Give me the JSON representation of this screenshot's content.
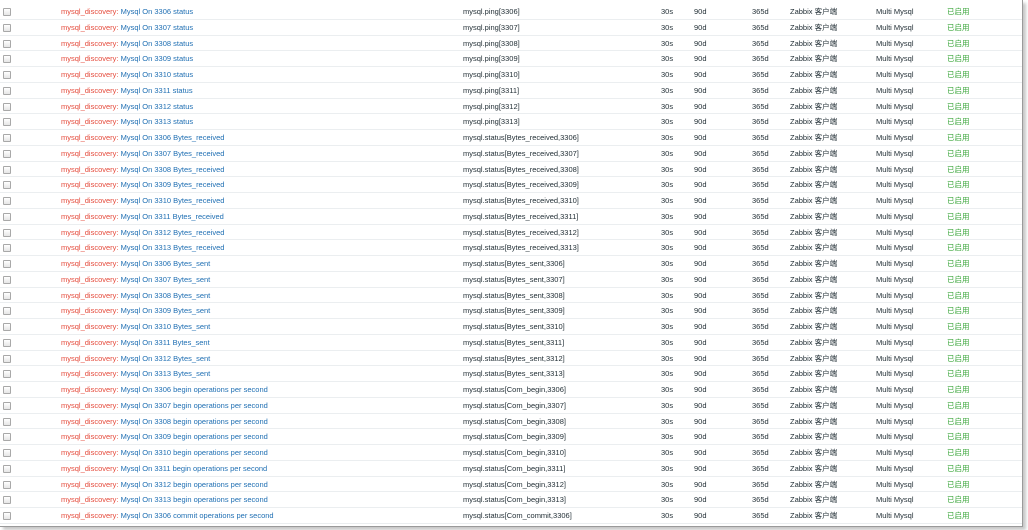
{
  "rows": [
    {
      "prefix": "mysql_discovery",
      "name": "Mysql On 3306 status",
      "key": "mysql.ping[3306]",
      "interval": "30s",
      "history": "90d",
      "trends": "365d",
      "type": "Zabbix 客户端",
      "app": "Multi Mysql",
      "status": "已启用"
    },
    {
      "prefix": "mysql_discovery",
      "name": "Mysql On 3307 status",
      "key": "mysql.ping[3307]",
      "interval": "30s",
      "history": "90d",
      "trends": "365d",
      "type": "Zabbix 客户端",
      "app": "Multi Mysql",
      "status": "已启用"
    },
    {
      "prefix": "mysql_discovery",
      "name": "Mysql On 3308 status",
      "key": "mysql.ping[3308]",
      "interval": "30s",
      "history": "90d",
      "trends": "365d",
      "type": "Zabbix 客户端",
      "app": "Multi Mysql",
      "status": "已启用"
    },
    {
      "prefix": "mysql_discovery",
      "name": "Mysql On 3309 status",
      "key": "mysql.ping[3309]",
      "interval": "30s",
      "history": "90d",
      "trends": "365d",
      "type": "Zabbix 客户端",
      "app": "Multi Mysql",
      "status": "已启用"
    },
    {
      "prefix": "mysql_discovery",
      "name": "Mysql On 3310 status",
      "key": "mysql.ping[3310]",
      "interval": "30s",
      "history": "90d",
      "trends": "365d",
      "type": "Zabbix 客户端",
      "app": "Multi Mysql",
      "status": "已启用"
    },
    {
      "prefix": "mysql_discovery",
      "name": "Mysql On 3311 status",
      "key": "mysql.ping[3311]",
      "interval": "30s",
      "history": "90d",
      "trends": "365d",
      "type": "Zabbix 客户端",
      "app": "Multi Mysql",
      "status": "已启用"
    },
    {
      "prefix": "mysql_discovery",
      "name": "Mysql On 3312 status",
      "key": "mysql.ping[3312]",
      "interval": "30s",
      "history": "90d",
      "trends": "365d",
      "type": "Zabbix 客户端",
      "app": "Multi Mysql",
      "status": "已启用"
    },
    {
      "prefix": "mysql_discovery",
      "name": "Mysql On 3313 status",
      "key": "mysql.ping[3313]",
      "interval": "30s",
      "history": "90d",
      "trends": "365d",
      "type": "Zabbix 客户端",
      "app": "Multi Mysql",
      "status": "已启用"
    },
    {
      "prefix": "mysql_discovery",
      "name": "Mysql On 3306 Bytes_received",
      "key": "mysql.status[Bytes_received,3306]",
      "interval": "30s",
      "history": "90d",
      "trends": "365d",
      "type": "Zabbix 客户端",
      "app": "Multi Mysql",
      "status": "已启用"
    },
    {
      "prefix": "mysql_discovery",
      "name": "Mysql On 3307 Bytes_received",
      "key": "mysql.status[Bytes_received,3307]",
      "interval": "30s",
      "history": "90d",
      "trends": "365d",
      "type": "Zabbix 客户端",
      "app": "Multi Mysql",
      "status": "已启用"
    },
    {
      "prefix": "mysql_discovery",
      "name": "Mysql On 3308 Bytes_received",
      "key": "mysql.status[Bytes_received,3308]",
      "interval": "30s",
      "history": "90d",
      "trends": "365d",
      "type": "Zabbix 客户端",
      "app": "Multi Mysql",
      "status": "已启用"
    },
    {
      "prefix": "mysql_discovery",
      "name": "Mysql On 3309 Bytes_received",
      "key": "mysql.status[Bytes_received,3309]",
      "interval": "30s",
      "history": "90d",
      "trends": "365d",
      "type": "Zabbix 客户端",
      "app": "Multi Mysql",
      "status": "已启用"
    },
    {
      "prefix": "mysql_discovery",
      "name": "Mysql On 3310 Bytes_received",
      "key": "mysql.status[Bytes_received,3310]",
      "interval": "30s",
      "history": "90d",
      "trends": "365d",
      "type": "Zabbix 客户端",
      "app": "Multi Mysql",
      "status": "已启用"
    },
    {
      "prefix": "mysql_discovery",
      "name": "Mysql On 3311 Bytes_received",
      "key": "mysql.status[Bytes_received,3311]",
      "interval": "30s",
      "history": "90d",
      "trends": "365d",
      "type": "Zabbix 客户端",
      "app": "Multi Mysql",
      "status": "已启用"
    },
    {
      "prefix": "mysql_discovery",
      "name": "Mysql On 3312 Bytes_received",
      "key": "mysql.status[Bytes_received,3312]",
      "interval": "30s",
      "history": "90d",
      "trends": "365d",
      "type": "Zabbix 客户端",
      "app": "Multi Mysql",
      "status": "已启用"
    },
    {
      "prefix": "mysql_discovery",
      "name": "Mysql On 3313 Bytes_received",
      "key": "mysql.status[Bytes_received,3313]",
      "interval": "30s",
      "history": "90d",
      "trends": "365d",
      "type": "Zabbix 客户端",
      "app": "Multi Mysql",
      "status": "已启用"
    },
    {
      "prefix": "mysql_discovery",
      "name": "Mysql On 3306 Bytes_sent",
      "key": "mysql.status[Bytes_sent,3306]",
      "interval": "30s",
      "history": "90d",
      "trends": "365d",
      "type": "Zabbix 客户端",
      "app": "Multi Mysql",
      "status": "已启用"
    },
    {
      "prefix": "mysql_discovery",
      "name": "Mysql On 3307 Bytes_sent",
      "key": "mysql.status[Bytes_sent,3307]",
      "interval": "30s",
      "history": "90d",
      "trends": "365d",
      "type": "Zabbix 客户端",
      "app": "Multi Mysql",
      "status": "已启用"
    },
    {
      "prefix": "mysql_discovery",
      "name": "Mysql On 3308 Bytes_sent",
      "key": "mysql.status[Bytes_sent,3308]",
      "interval": "30s",
      "history": "90d",
      "trends": "365d",
      "type": "Zabbix 客户端",
      "app": "Multi Mysql",
      "status": "已启用"
    },
    {
      "prefix": "mysql_discovery",
      "name": "Mysql On 3309 Bytes_sent",
      "key": "mysql.status[Bytes_sent,3309]",
      "interval": "30s",
      "history": "90d",
      "trends": "365d",
      "type": "Zabbix 客户端",
      "app": "Multi Mysql",
      "status": "已启用"
    },
    {
      "prefix": "mysql_discovery",
      "name": "Mysql On 3310 Bytes_sent",
      "key": "mysql.status[Bytes_sent,3310]",
      "interval": "30s",
      "history": "90d",
      "trends": "365d",
      "type": "Zabbix 客户端",
      "app": "Multi Mysql",
      "status": "已启用"
    },
    {
      "prefix": "mysql_discovery",
      "name": "Mysql On 3311 Bytes_sent",
      "key": "mysql.status[Bytes_sent,3311]",
      "interval": "30s",
      "history": "90d",
      "trends": "365d",
      "type": "Zabbix 客户端",
      "app": "Multi Mysql",
      "status": "已启用"
    },
    {
      "prefix": "mysql_discovery",
      "name": "Mysql On 3312 Bytes_sent",
      "key": "mysql.status[Bytes_sent,3312]",
      "interval": "30s",
      "history": "90d",
      "trends": "365d",
      "type": "Zabbix 客户端",
      "app": "Multi Mysql",
      "status": "已启用"
    },
    {
      "prefix": "mysql_discovery",
      "name": "Mysql On 3313 Bytes_sent",
      "key": "mysql.status[Bytes_sent,3313]",
      "interval": "30s",
      "history": "90d",
      "trends": "365d",
      "type": "Zabbix 客户端",
      "app": "Multi Mysql",
      "status": "已启用"
    },
    {
      "prefix": "mysql_discovery",
      "name": "Mysql On 3306 begin operations per second",
      "key": "mysql.status[Com_begin,3306]",
      "interval": "30s",
      "history": "90d",
      "trends": "365d",
      "type": "Zabbix 客户端",
      "app": "Multi Mysql",
      "status": "已启用"
    },
    {
      "prefix": "mysql_discovery",
      "name": "Mysql On 3307 begin operations per second",
      "key": "mysql.status[Com_begin,3307]",
      "interval": "30s",
      "history": "90d",
      "trends": "365d",
      "type": "Zabbix 客户端",
      "app": "Multi Mysql",
      "status": "已启用"
    },
    {
      "prefix": "mysql_discovery",
      "name": "Mysql On 3308 begin operations per second",
      "key": "mysql.status[Com_begin,3308]",
      "interval": "30s",
      "history": "90d",
      "trends": "365d",
      "type": "Zabbix 客户端",
      "app": "Multi Mysql",
      "status": "已启用"
    },
    {
      "prefix": "mysql_discovery",
      "name": "Mysql On 3309 begin operations per second",
      "key": "mysql.status[Com_begin,3309]",
      "interval": "30s",
      "history": "90d",
      "trends": "365d",
      "type": "Zabbix 客户端",
      "app": "Multi Mysql",
      "status": "已启用"
    },
    {
      "prefix": "mysql_discovery",
      "name": "Mysql On 3310 begin operations per second",
      "key": "mysql.status[Com_begin,3310]",
      "interval": "30s",
      "history": "90d",
      "trends": "365d",
      "type": "Zabbix 客户端",
      "app": "Multi Mysql",
      "status": "已启用"
    },
    {
      "prefix": "mysql_discovery",
      "name": "Mysql On 3311 begin operations per second",
      "key": "mysql.status[Com_begin,3311]",
      "interval": "30s",
      "history": "90d",
      "trends": "365d",
      "type": "Zabbix 客户端",
      "app": "Multi Mysql",
      "status": "已启用"
    },
    {
      "prefix": "mysql_discovery",
      "name": "Mysql On 3312 begin operations per second",
      "key": "mysql.status[Com_begin,3312]",
      "interval": "30s",
      "history": "90d",
      "trends": "365d",
      "type": "Zabbix 客户端",
      "app": "Multi Mysql",
      "status": "已启用"
    },
    {
      "prefix": "mysql_discovery",
      "name": "Mysql On 3313 begin operations per second",
      "key": "mysql.status[Com_begin,3313]",
      "interval": "30s",
      "history": "90d",
      "trends": "365d",
      "type": "Zabbix 客户端",
      "app": "Multi Mysql",
      "status": "已启用"
    },
    {
      "prefix": "mysql_discovery",
      "name": "Mysql On 3306 commit operations per second",
      "key": "mysql.status[Com_commit,3306]",
      "interval": "30s",
      "history": "90d",
      "trends": "365d",
      "type": "Zabbix 客户端",
      "app": "Multi Mysql",
      "status": "已启用"
    }
  ],
  "colors": {
    "prefix": "#e54b3c",
    "name_link": "#1f6fb3",
    "status_enabled": "#3aa63a"
  }
}
